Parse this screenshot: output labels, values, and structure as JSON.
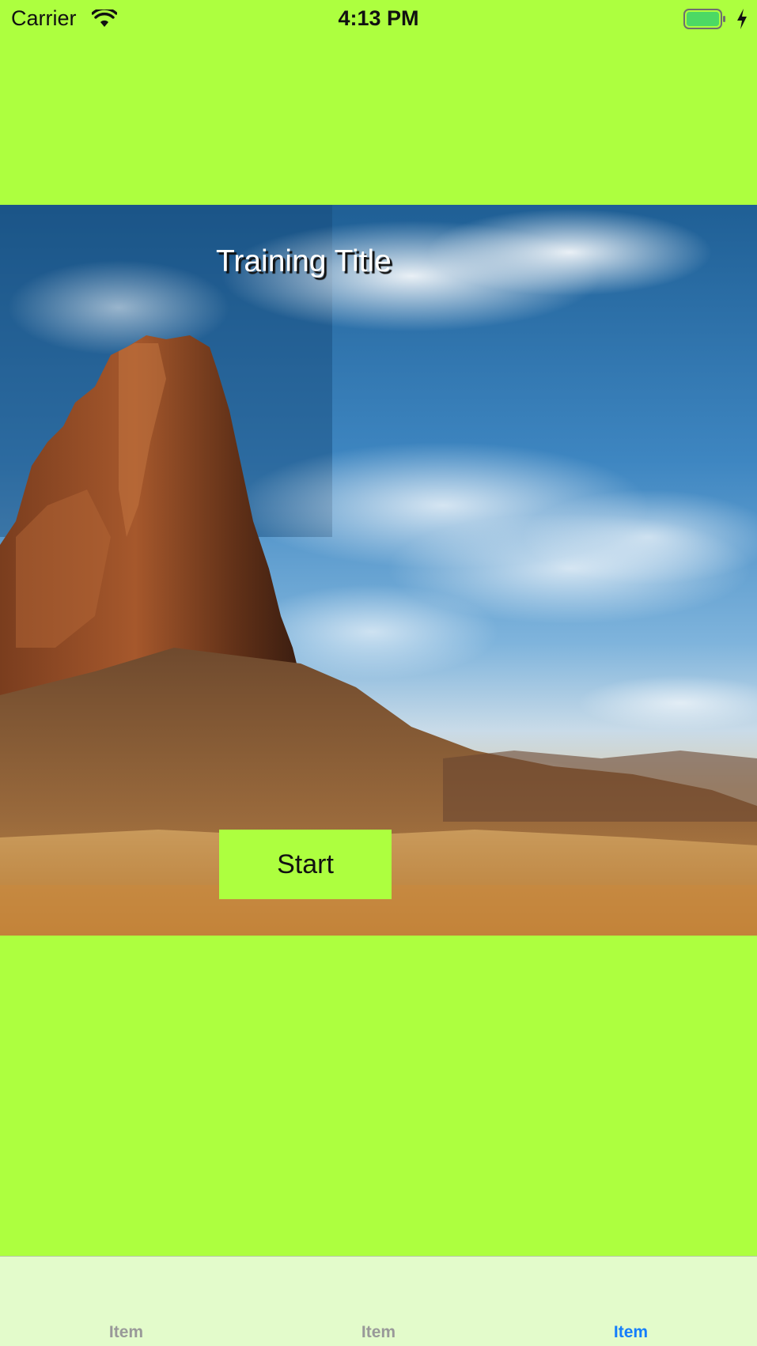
{
  "status_bar": {
    "carrier": "Carrier",
    "time": "4:13 PM",
    "wifi_icon": "wifi-icon",
    "battery_icon": "battery-charging-icon"
  },
  "hero": {
    "image": "desert-rock-landscape",
    "title": "Training Title",
    "start_label": "Start"
  },
  "tab_bar": {
    "selected_index": 2,
    "items": [
      {
        "label": "Item"
      },
      {
        "label": "Item"
      },
      {
        "label": "Item"
      }
    ]
  },
  "colors": {
    "background": "#adff3f",
    "accent": "#157efb",
    "tab_inactive": "#999999",
    "tab_bar_bg": "#e3fbcb"
  }
}
